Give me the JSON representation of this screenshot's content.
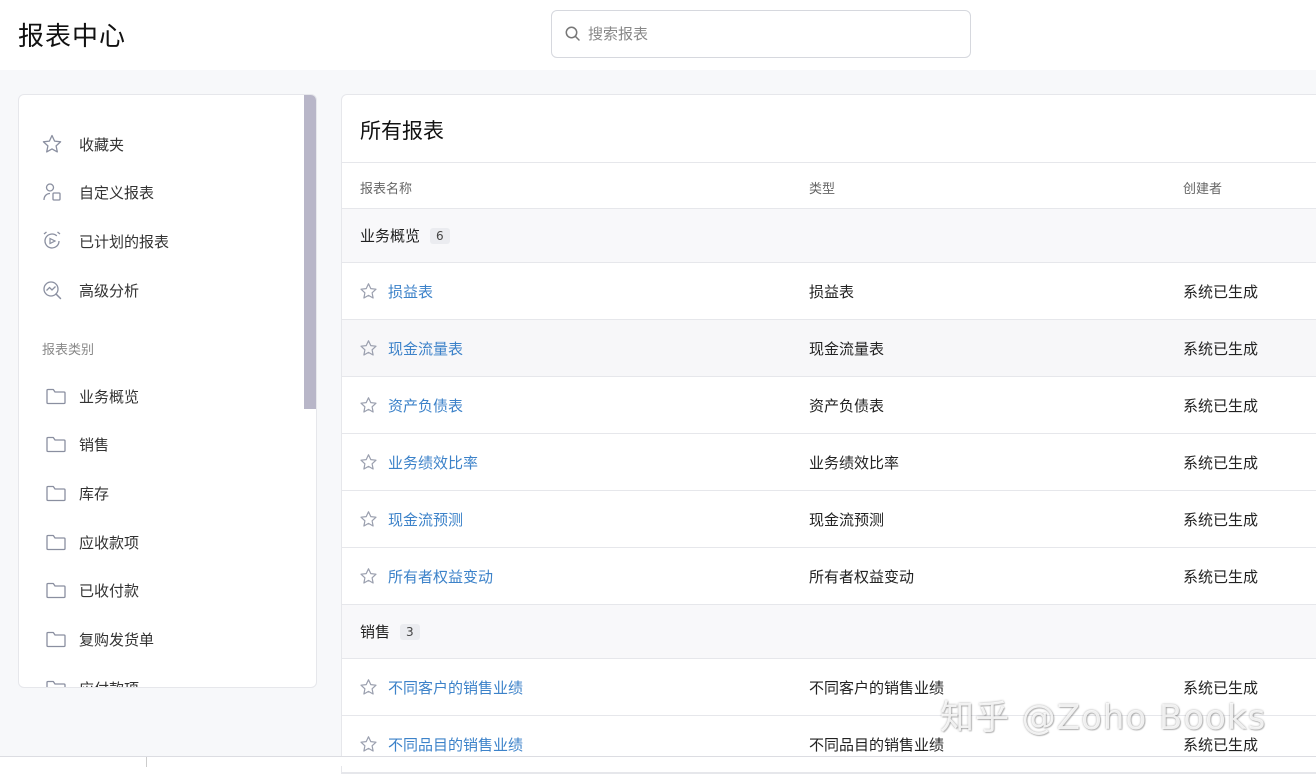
{
  "header": {
    "title": "报表中心",
    "search_placeholder": "搜索报表"
  },
  "sidebar": {
    "nav": [
      {
        "label": "收藏夹",
        "icon": "star-icon"
      },
      {
        "label": "自定义报表",
        "icon": "user-report-icon"
      },
      {
        "label": "已计划的报表",
        "icon": "scheduled-icon"
      },
      {
        "label": "高级分析",
        "icon": "analytics-icon"
      }
    ],
    "section_label": "报表类别",
    "categories": [
      {
        "label": "业务概览",
        "icon": "folder-icon"
      },
      {
        "label": "销售",
        "icon": "folder-icon"
      },
      {
        "label": "库存",
        "icon": "folder-icon"
      },
      {
        "label": "应收款项",
        "icon": "folder-icon"
      },
      {
        "label": "已收付款",
        "icon": "folder-icon"
      },
      {
        "label": "复购发货单",
        "icon": "folder-icon"
      },
      {
        "label": "应付款项",
        "icon": "folder-icon"
      }
    ]
  },
  "main": {
    "title": "所有报表",
    "columns": [
      "报表名称",
      "类型",
      "创建者"
    ],
    "groups": [
      {
        "name": "业务概览",
        "count": "6"
      },
      {
        "name": "销售",
        "count": "3"
      }
    ],
    "rows": [
      {
        "name": "损益表",
        "type": "损益表",
        "creator": "系统已生成"
      },
      {
        "name": "现金流量表",
        "type": "现金流量表",
        "creator": "系统已生成"
      },
      {
        "name": "资产负债表",
        "type": "资产负债表",
        "creator": "系统已生成"
      },
      {
        "name": "业务绩效比率",
        "type": "业务绩效比率",
        "creator": "系统已生成"
      },
      {
        "name": "现金流预测",
        "type": "现金流预测",
        "creator": "系统已生成"
      },
      {
        "name": "所有者权益变动",
        "type": "所有者权益变动",
        "creator": "系统已生成"
      },
      {
        "name": "不同客户的销售业绩",
        "type": "不同客户的销售业绩",
        "creator": "系统已生成"
      },
      {
        "name": "不同品目的销售业绩",
        "type": "不同品目的销售业绩",
        "creator": "系统已生成"
      }
    ]
  },
  "watermark": "知乎 @Zoho Books",
  "colors": {
    "link": "#3c82c9",
    "scrollbar": "#b8b6c8",
    "border": "#e6e7eb"
  }
}
